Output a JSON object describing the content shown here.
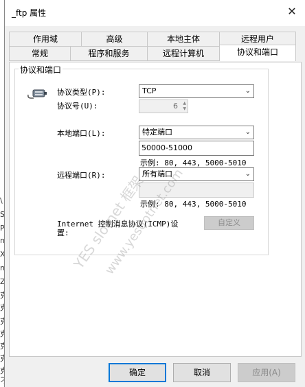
{
  "window": {
    "title": "_ftp 属性",
    "close_glyph": "✕"
  },
  "tabs_row1": [
    "作用域",
    "高级",
    "本地主体",
    "远程用户"
  ],
  "tabs_row2": [
    "常规",
    "程序和服务",
    "远程计算机",
    "协议和端口"
  ],
  "active_tab": "协议和端口",
  "group": {
    "title": "协议和端口",
    "protocol_type_label": "协议类型(P):",
    "protocol_type_value": "TCP",
    "protocol_number_label": "协议号(U):",
    "protocol_number_value": "6",
    "local_port_label": "本地端口(L):",
    "local_port_value": "特定端口",
    "local_port_input": "50000-51000",
    "local_example": "示例: 80, 443, 5000-5010",
    "remote_port_label": "远程端口(R):",
    "remote_port_value": "所有端口",
    "remote_port_input": "",
    "remote_example": "示例: 80, 443, 5000-5010",
    "icmp_label_line1": "Internet 控制消息协议(ICMP)设",
    "icmp_label_line2": "置:",
    "customize_label": "自定义"
  },
  "buttons": {
    "ok": "确定",
    "cancel": "取消",
    "apply": "应用(A)"
  },
  "watermarks": [
    "YES slotnet 框架",
    "www.yesdotnet.com"
  ],
  "background_chars": [
    "\\",
    "S",
    "P",
    "n",
    "X",
    "n",
    "Z",
    "克",
    "克",
    "克",
    "克",
    "克",
    "克",
    "克",
    "刁"
  ]
}
